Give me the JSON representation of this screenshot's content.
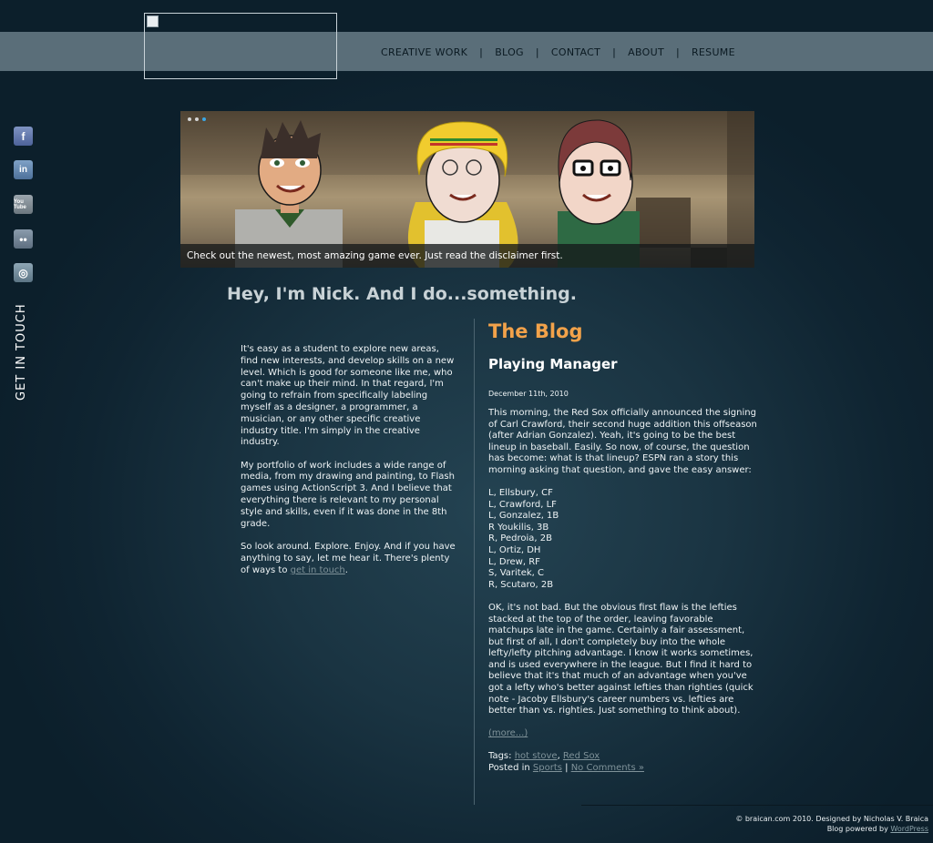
{
  "nav": {
    "items": [
      "CREATIVE WORK",
      "BLOG",
      "CONTACT",
      "ABOUT",
      "RESUME"
    ],
    "separator": "|"
  },
  "social": {
    "facebook": "f",
    "linkedin": "in",
    "youtube": "You Tube",
    "flickr": "••",
    "rss": "◎",
    "get_in_touch": "GET IN TOUCH"
  },
  "banner": {
    "caption": "Check out the newest, most amazing game ever. Just read the disclaimer first.",
    "active_slide": 3,
    "slide_count": 3
  },
  "headline": "Hey, I'm Nick. And I do...something.",
  "intro": {
    "p1": "It's easy as a student to explore new areas, find new interests, and develop skills on a new level. Which is good for someone like me, who can't make up their mind. In that regard, I'm going to refrain from specifically labeling myself as a designer, a programmer, a musician, or any other specific creative industry title. I'm simply in the creative industry.",
    "p2": "My portfolio of work includes a wide range of media, from my drawing and painting, to Flash games using ActionScript 3. And I believe that everything there is relevant to my personal style and skills, even if it was done in the 8th grade.",
    "p3_before": "So look around. Explore. Enjoy. And if you have anything to say, let me hear it. There's plenty of ways to ",
    "p3_link": "get in touch",
    "p3_after": "."
  },
  "blog": {
    "title": "The Blog",
    "post_title": "Playing Manager",
    "date": "December 11th, 2010",
    "p1": "This morning, the Red Sox officially announced the signing of Carl Crawford, their second huge addition this offseason (after Adrian Gonzalez). Yeah, it's going to be the best lineup in baseball. Easily. So now, of course, the question has become: what is that lineup? ESPN ran a story this morning asking that question, and gave the easy answer:",
    "lineup": [
      "L, Ellsbury, CF",
      "L, Crawford, LF",
      "L, Gonzalez, 1B",
      "R Youkilis, 3B",
      "R, Pedroia, 2B",
      "L, Ortiz, DH",
      "L, Drew, RF",
      "S, Varitek, C",
      "R, Scutaro, 2B"
    ],
    "p2": "OK, it's not bad. But the obvious first flaw is the lefties stacked at the top of the order, leaving favorable matchups late in the game. Certainly a fair assessment, but first of all, I don't completely buy into the whole lefty/lefty pitching advantage. I know it works sometimes, and is used everywhere in the league. But I find it hard to believe that it's that much of an advantage when you've got a lefty who's better against lefties than righties (quick note - Jacoby Ellsbury's career numbers vs. lefties are better than vs. righties. Just something to think about).",
    "more": "(more...)",
    "tags_label": "Tags: ",
    "tag1": "hot stove",
    "tag_sep": ", ",
    "tag2": "Red Sox",
    "posted_label": "Posted in ",
    "category": "Sports",
    "posted_sep": " | ",
    "comments": "No Comments »"
  },
  "footer": {
    "line1": "© braican.com 2010. Designed by Nicholas V. Braica",
    "line2_before": "Blog powered by ",
    "line2_link": "WordPress"
  },
  "colors": {
    "background": "#1a3442",
    "topbar": "#5a6e79",
    "blog_title": "#f2a24a",
    "link": "#7f9299",
    "active_dot": "#3aa7e6"
  }
}
